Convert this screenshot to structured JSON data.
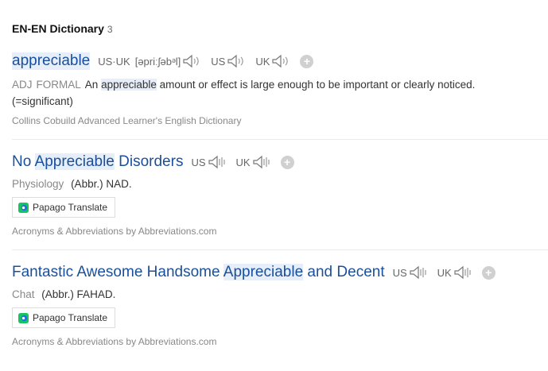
{
  "section": {
    "title": "EN-EN Dictionary",
    "count": "3"
  },
  "entries": [
    {
      "headword": "appreciable",
      "pron": {
        "uk_us_label": "US·UK",
        "ipa": "[əpriːʃəbᵊl]",
        "us_label": "US",
        "uk_label": "UK"
      },
      "def": {
        "pos": "ADJ",
        "register": "FORMAL",
        "pre": "An",
        "hl": "appreciable",
        "post": "amount or effect is large enough to be important or clearly noticed.",
        "extra": "(=significant)"
      },
      "source": "Collins Cobuild Advanced Learner's English Dictionary"
    },
    {
      "headword_pre": "No",
      "headword_hl": "Appreciable",
      "headword_post": "Disorders",
      "pron": {
        "us_label": "US",
        "uk_label": "UK"
      },
      "field": "Physiology",
      "abbr": "(Abbr.) NAD.",
      "translate_label": "Papago Translate",
      "source": "Acronyms & Abbreviations by Abbreviations.com"
    },
    {
      "headword_pre": "Fantastic Awesome Handsome",
      "headword_hl": "Appreciable",
      "headword_post": "and Decent",
      "pron": {
        "us_label": "US",
        "uk_label": "UK"
      },
      "field": "Chat",
      "abbr": "(Abbr.) FAHAD.",
      "translate_label": "Papago Translate",
      "source": "Acronyms & Abbreviations by Abbreviations.com"
    }
  ],
  "icons": {
    "speaker": "speaker-icon",
    "add": "plus-icon",
    "papago": "papago-logo-icon"
  },
  "colors": {
    "headword": "#1a4f9c",
    "highlight": "#e6eef9",
    "muted": "#888888"
  }
}
